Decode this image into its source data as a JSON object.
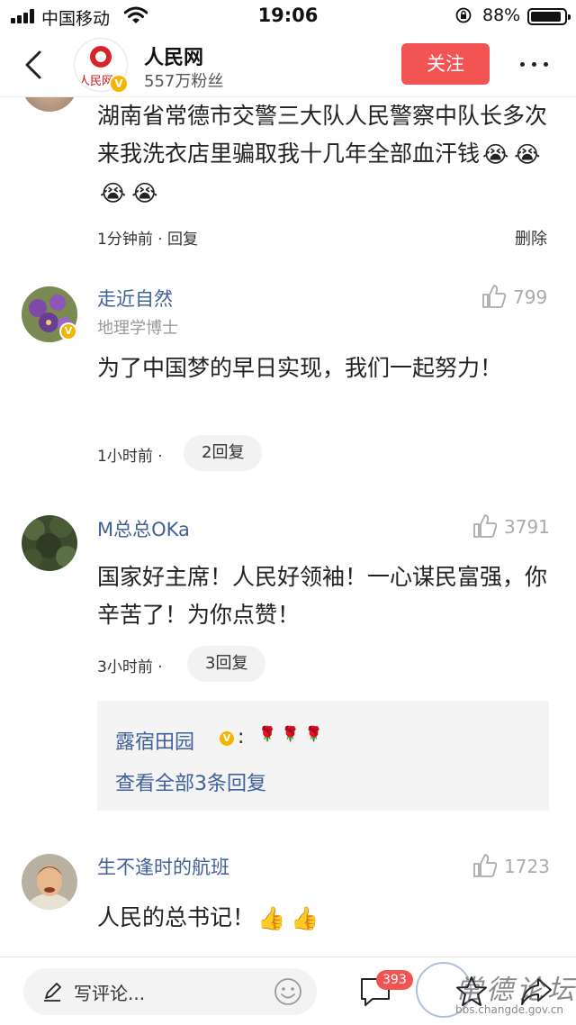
{
  "status_bar": {
    "carrier": "中国移动",
    "time": "19:06",
    "battery_percent": "88%",
    "battery_level": 0.88,
    "icons": [
      "signal-icon",
      "wifi-icon",
      "orientation-lock-icon",
      "battery-icon"
    ]
  },
  "nav": {
    "title": "人民网",
    "fans": "557万粉丝",
    "follow_label": "关注",
    "avatar_logo_text": "人民网 people",
    "verified_mark": "V",
    "icons": [
      "back-icon",
      "more-icon"
    ]
  },
  "comments": [
    {
      "content": "湖南省常德市交警三大队人民警察中队长多次来我洗衣店里骗取我十几年全部血汗钱",
      "emoji": [
        "😭",
        "😭",
        "😭",
        "😭"
      ],
      "time": "1分钟前 · 回复",
      "delete_label": "删除"
    },
    {
      "username": "走近自然",
      "title": "地理学博士",
      "likes": "799",
      "content": "为了中国梦的早日实现，我们一起努力！",
      "time": "1小时前 ·",
      "reply_count_label": "2回复"
    },
    {
      "username": "M总总OKa",
      "likes": "3791",
      "content": "国家好主席！人民好领袖！一心谋民富强，你辛苦了！为你点赞！",
      "time": "3小时前 ·",
      "reply_count_label": "3回复",
      "reply_preview": {
        "name": "露宿田园",
        "colon": ":",
        "emoji": [
          "🌹",
          "🌹",
          "🌹"
        ],
        "view_all": "查看全部3条回复"
      }
    },
    {
      "username": "生不逢时的航班",
      "likes": "1723",
      "content": "人民的总书记！",
      "emoji": [
        "👍",
        "👍"
      ]
    }
  ],
  "bottom_bar": {
    "input_placeholder": "写评论...",
    "comment_count": "393",
    "icons": [
      "pen-icon",
      "emoji-icon",
      "comment-icon",
      "star-icon",
      "share-icon"
    ]
  },
  "watermark": {
    "name": "常德论坛",
    "url": "bbs.changde.gov.cn"
  },
  "colors": {
    "accent_red": "#f25353",
    "username_blue": "#40609a",
    "verified_gold": "#f5b400",
    "muted_gray": "#999999"
  }
}
